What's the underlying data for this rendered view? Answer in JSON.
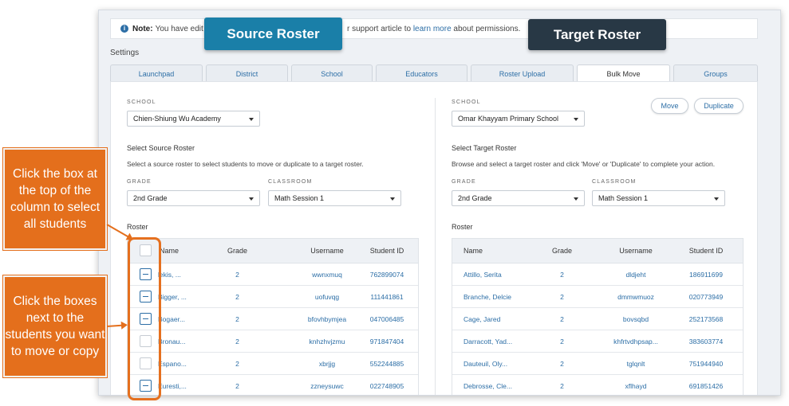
{
  "note": {
    "bold": "Note:",
    "text_before": "You have edit acc",
    "text_after": "r support article to",
    "link": "learn more",
    "text_end": "about permissions."
  },
  "settings_label": "Settings",
  "tabs": [
    {
      "label": "Launchpad"
    },
    {
      "label": "District"
    },
    {
      "label": "School"
    },
    {
      "label": "Educators"
    },
    {
      "label": "Roster Upload"
    },
    {
      "label": "Bulk Move"
    },
    {
      "label": "Groups"
    }
  ],
  "source": {
    "school_caption": "SCHOOL",
    "school_value": "Chien-Shiung Wu Academy",
    "heading": "Select Source Roster",
    "description": "Select a source roster to select students to move or duplicate to a target roster.",
    "grade_caption": "GRADE",
    "grade_value": "2nd Grade",
    "classroom_caption": "CLASSROOM",
    "classroom_value": "Math Session 1",
    "roster_label": "Roster",
    "columns": [
      "Name",
      "Grade",
      "Username",
      "Student ID"
    ],
    "rows": [
      {
        "name": "lekis, ...",
        "grade": "2",
        "username": "wwnxmuq",
        "id": "762899074",
        "checked": true
      },
      {
        "name": "Bigger, ...",
        "grade": "2",
        "username": "uofuvqg",
        "id": "111441861",
        "checked": true
      },
      {
        "name": "Bogaer...",
        "grade": "2",
        "username": "bfovhbymjea",
        "id": "047006485",
        "checked": true
      },
      {
        "name": "Bronau...",
        "grade": "2",
        "username": "knhzhvjzmu",
        "id": "971847404",
        "checked": false
      },
      {
        "name": "Espano...",
        "grade": "2",
        "username": "xbrjjg",
        "id": "552244885",
        "checked": false
      },
      {
        "name": "Euresti,...",
        "grade": "2",
        "username": "zzneysuwc",
        "id": "022748905",
        "checked": true
      }
    ]
  },
  "target": {
    "school_caption": "SCHOOL",
    "school_value": "Omar Khayyam Primary School",
    "move_label": "Move",
    "duplicate_label": "Duplicate",
    "heading": "Select Target Roster",
    "description": "Browse and select a target roster and click 'Move' or 'Duplicate' to complete your action.",
    "grade_caption": "GRADE",
    "grade_value": "2nd Grade",
    "classroom_caption": "CLASSROOM",
    "classroom_value": "Math Session 1",
    "roster_label": "Roster",
    "columns": [
      "Name",
      "Grade",
      "Username",
      "Student ID"
    ],
    "rows": [
      {
        "name": "Attillo, Serita",
        "grade": "2",
        "username": "dldjeht",
        "id": "186911699"
      },
      {
        "name": "Branche, Delcie",
        "grade": "2",
        "username": "dmmwmuoz",
        "id": "020773949"
      },
      {
        "name": "Cage, Jared",
        "grade": "2",
        "username": "bovsqbd",
        "id": "252173568"
      },
      {
        "name": "Darracott, Yad...",
        "grade": "2",
        "username": "khfrtvdhpsap...",
        "id": "383603774"
      },
      {
        "name": "Dauteuil, Oly...",
        "grade": "2",
        "username": "tglqnlt",
        "id": "751944940"
      },
      {
        "name": "Debrosse, Cle...",
        "grade": "2",
        "username": "xflhayd",
        "id": "691851426"
      }
    ]
  },
  "labels": {
    "source_roster": "Source Roster",
    "target_roster": "Target Roster"
  },
  "callouts": {
    "select_all": "Click the box at the top of the column to select all students",
    "select_some": "Click the boxes next to the students you want to move or copy"
  },
  "colors": {
    "accent": "#e46f1c",
    "source_label_bg": "#1a7fa8",
    "target_label_bg": "#283845",
    "link_blue": "#2c6ea6"
  }
}
